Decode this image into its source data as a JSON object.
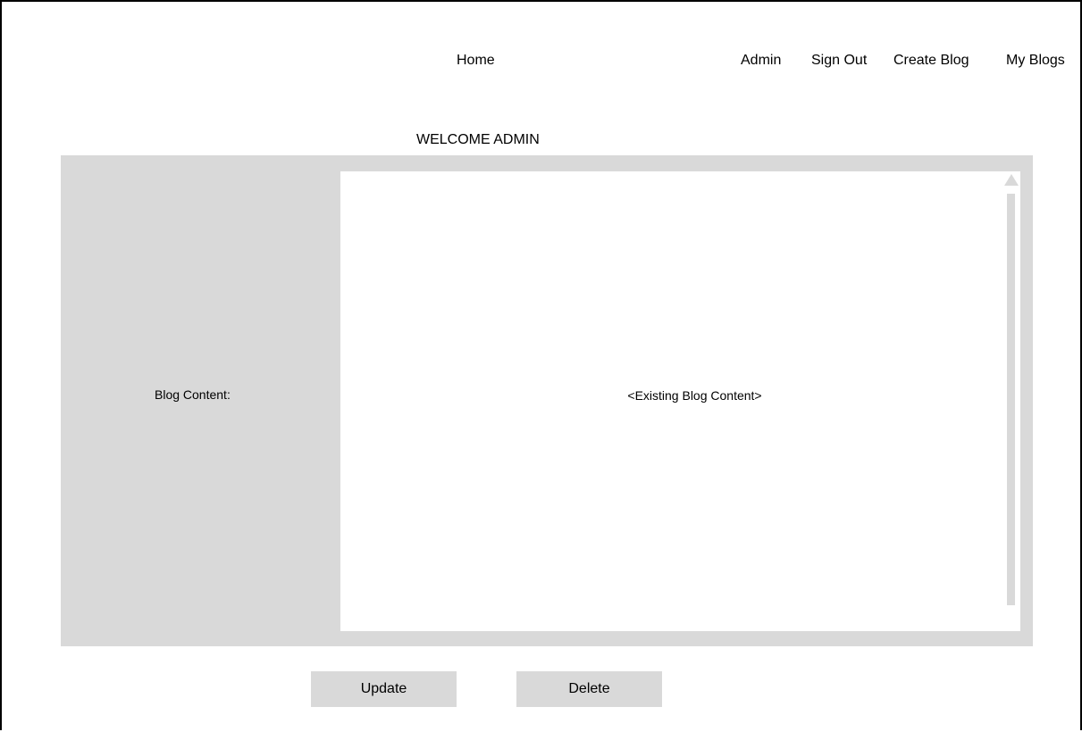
{
  "nav": {
    "home": "Home",
    "admin": "Admin",
    "sign_out": "Sign Out",
    "create_blog": "Create Blog",
    "my_blogs": "My Blogs"
  },
  "page": {
    "welcome": "WELCOME ADMIN"
  },
  "form": {
    "label": "Blog Content:",
    "content": "<Existing Blog Content>"
  },
  "actions": {
    "update": "Update",
    "delete": "Delete"
  },
  "colors": {
    "panel": "#d9d9d9",
    "text": "#000000",
    "background": "#ffffff"
  }
}
